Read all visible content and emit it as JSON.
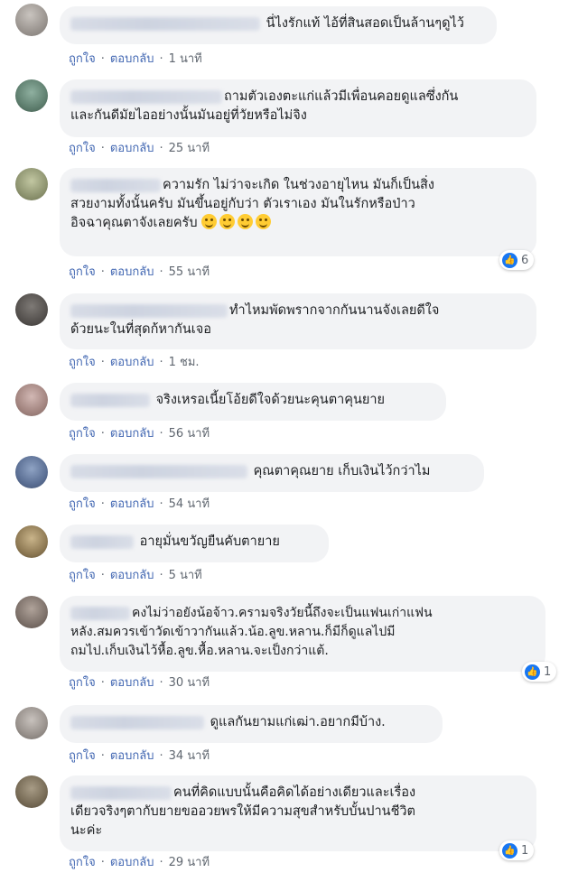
{
  "actions": {
    "like": "ถูกใจ",
    "reply": "ตอบกลับ",
    "separator": "·"
  },
  "comments": [
    {
      "lines": [
        "นี่ไงรักแท้ ไอ้ที่สินสอดเป็นล้านๆดูไว้"
      ],
      "time": "1 นาที",
      "likes": ""
    },
    {
      "lines": [
        "ถามตัวเองตะแก่แล้วมีเพื่อนคอยดูแลซึ่งกัน",
        "และกันดีมัยไออย่างนั้นมันอยู่ที่วัยหรือไม่จิง"
      ],
      "time": "25 นาที",
      "likes": ""
    },
    {
      "lines": [
        "ความรัก ไม่ว่าจะเกิด ในช่วงอายุไหน มันก็เป็นสิ่ง",
        "สวยงามทั้งนั้นครับ มันขึ้นอยู่กับว่า ตัวเราเอง มันในรักหรือป่าว",
        "อิจฉาคุณตาจังเลยครับ"
      ],
      "time": "55 นาที",
      "likes": "6"
    },
    {
      "lines": [
        "ทำไหมพัดพรากจากกันนานจังเลยดีใจ",
        "ด้วยนะในที่สุดก้หากันเจอ"
      ],
      "time": "1 ชม.",
      "likes": ""
    },
    {
      "lines": [
        "จริงเหรอเนี้ยโอ้ยดีใจด้วยนะคุนตาคุนยาย"
      ],
      "time": "56 นาที",
      "likes": ""
    },
    {
      "lines": [
        "คุณตาคุณยาย เก็บเงินไว้กว่าไม"
      ],
      "time": "54 นาที",
      "likes": ""
    },
    {
      "lines": [
        "อายุมั่นขวัญยืนคับตายาย"
      ],
      "time": "5 นาที",
      "likes": ""
    },
    {
      "lines": [
        "คงไม่ว่าอยังน้อจ้าว.ครามจริงวัยนี้ถึงจะเป็นแฟนเก่าแฟน",
        "หลัง.สมควรเข้าวัดเข้าวากันแล้ว.น้อ.ลูข.หลาน.ก็มีก็ดูแลไปมี",
        "ถมไป.เก็บเงินไว้หื้อ.ลูข.หื้อ.หลาน.จะเป็งกว่าแต้."
      ],
      "time": "30 นาที",
      "likes": "1"
    },
    {
      "lines": [
        "ดูแลกันยามแก่เฒ่า.อยากมีบ้าง."
      ],
      "time": "34 นาที",
      "likes": ""
    },
    {
      "lines": [
        "คนที่คิดแบบนั้นคือคิดได้อย่างเดียวและเรื่อง",
        "เดียวจริงๆตากับยายขออวยพรให้มีความสุขสำหรับบั้นปานชีวิต",
        "นะค่ะ"
      ],
      "time": "29 นาที",
      "likes": "1"
    }
  ]
}
